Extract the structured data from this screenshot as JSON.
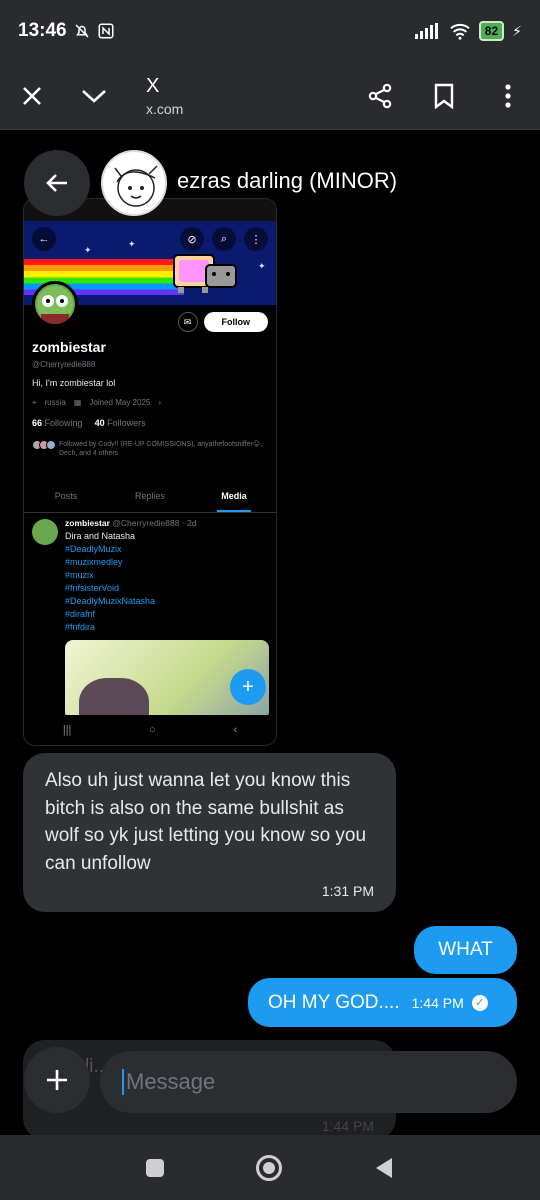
{
  "status_bar": {
    "time": "13:46",
    "battery": "82"
  },
  "toolbar": {
    "title": "X",
    "url": "x.com"
  },
  "conversation": {
    "name": "ezras darling (MINOR)"
  },
  "screenshot": {
    "profile": {
      "name": "zombiestar",
      "handle": "@Cherryredie888",
      "bio": "Hi, I'm zombiestar lol",
      "location": "russia",
      "joined": "Joined May 2025",
      "following_count": "66",
      "following_label": "Following",
      "followers_count": "40",
      "followers_label": "Followers",
      "followed_by": "Followed by Cody!! (RE-UP COMISSIONS), anyathefootsniffer😛, Dech, and 4 others",
      "follow_button": "Follow"
    },
    "tabs": [
      "Posts",
      "Replies",
      "Media"
    ],
    "post": {
      "author": "zombiestar",
      "meta": "@Cherryredie888 · 2d",
      "text": "Dira and Natasha",
      "hashtags": [
        "#DeadlyMuzix",
        "#muzixmedley",
        "#muzix",
        "#fnfsisterVoid",
        "#DeadlyMuzixNatasha",
        "#dirafnf",
        "#fnfdira"
      ]
    }
  },
  "messages": {
    "incoming": {
      "text": "Also uh just wanna let you know this bitch is also on the same bullshit as wolf so yk just letting you know so you can unfollow",
      "time": "1:31 PM"
    },
    "outgoing1": {
      "text": "WHAT"
    },
    "outgoing2": {
      "text": "OH MY GOD....",
      "time": "1:44 PM"
    },
    "ghost": {
      "text": "li...",
      "time": "1:44 PM"
    }
  },
  "composer": {
    "placeholder": "Message"
  },
  "colors": {
    "accent": "#1d9bf0",
    "bubble_in": "#2f3336",
    "background": "#000000"
  }
}
